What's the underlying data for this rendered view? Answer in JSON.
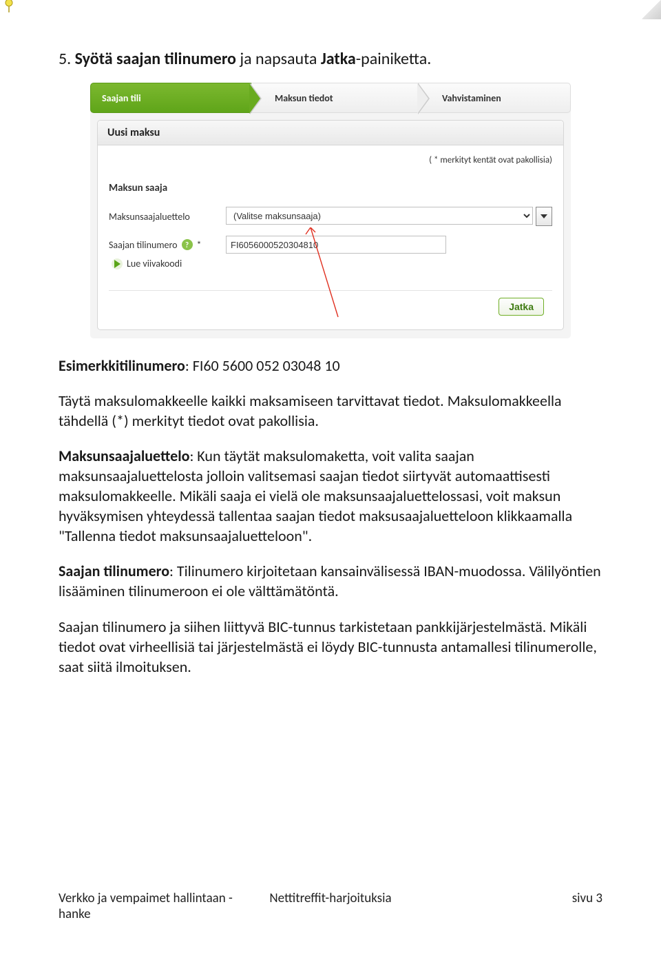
{
  "step_number": "5.",
  "step_prefix": "Syötä saajan ",
  "step_bold1": "tilinumero",
  "step_mid": " ja napsauta ",
  "step_bold2": "Jatka",
  "step_suffix": "-painiketta.",
  "ui": {
    "tab1": "Saajan tili",
    "tab2": "Maksun tiedot",
    "tab3": "Vahvistaminen",
    "panel_title": "Uusi maksu",
    "req_note": "( * merkityt kentät ovat pakollisia)",
    "section_label": "Maksun saaja",
    "row1_label": "Maksunsaajaluettelo",
    "row1_value": "(Valitse maksunsaaja)",
    "row2_label": "Saajan tilinumero",
    "row2_value": "FI6056000520304810",
    "row2_asterisk": "*",
    "barcode_label": "Lue viivakoodi",
    "continue_btn": "Jatka"
  },
  "example": {
    "label": "Esimerkkitilinumero",
    "value": ": FI60 5600 052 03048 10"
  },
  "p1": "Täytä maksulomakkeelle kaikki maksamiseen tarvittavat tiedot. Maksulomakkeella tähdellä (*) merkityt tiedot ovat pakollisia.",
  "p2_bold": "Maksunsaajaluettelo",
  "p2_text": ": Kun täytät maksulomaketta, voit valita saajan maksunsaajaluettelosta jolloin valitsemasi saajan tiedot siirtyvät automaattisesti maksulomakkeelle. Mikäli saaja ei vielä ole maksunsaajaluettelossasi, voit maksun hyväksymisen yhteydessä tallentaa saajan tiedot maksusaajaluetteloon klikkaamalla \"Tallenna tiedot maksunsaajaluetteloon\".",
  "p3_bold": "Saajan tilinumero",
  "p3_text": ": Tilinumero kirjoitetaan kansainvälisessä IBAN-muodossa. Välilyöntien lisääminen tilinumeroon ei ole välttämätöntä.",
  "p4": "Saajan tilinumero ja siihen liittyvä BIC-tunnus tarkistetaan pankkijärjestelmästä. Mikäli tiedot ovat virheellisiä tai järjestelmästä ei löydy BIC-tunnusta antamallesi tilinumerolle, saat siitä ilmoituksen.",
  "footer": {
    "left": "Verkko ja vempaimet hallintaan -hanke",
    "center": "Nettitreffit-harjoituksia",
    "right": "sivu 3"
  }
}
